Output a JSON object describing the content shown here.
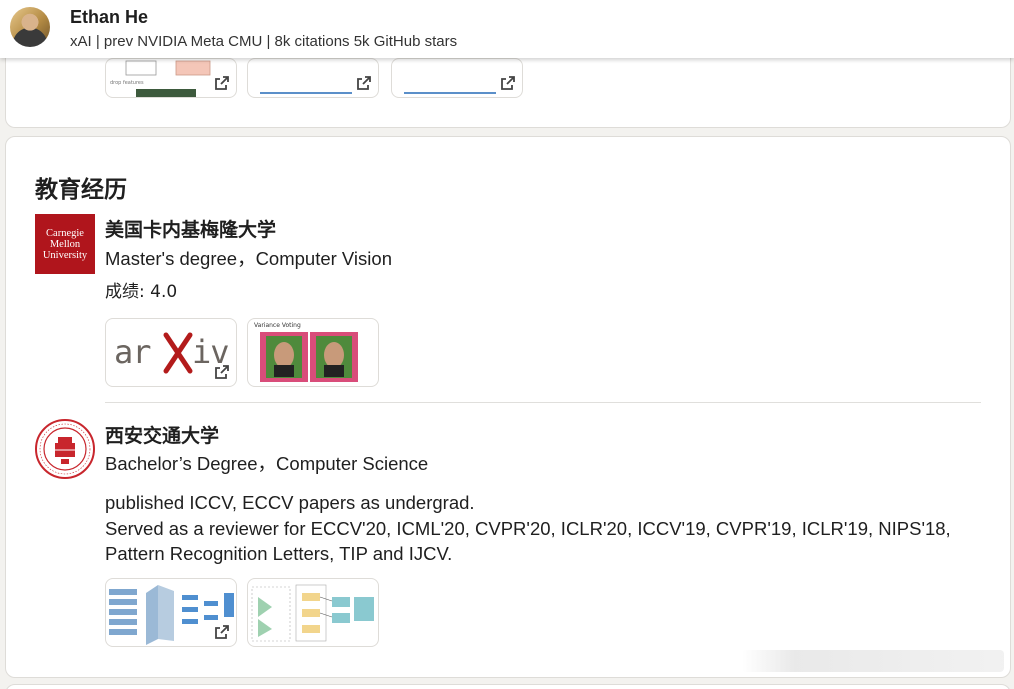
{
  "header": {
    "name": "Ethan He",
    "headline": "xAI | prev NVIDIA Meta CMU | 8k citations 5k GitHub stars"
  },
  "education": {
    "title": "教育经历",
    "schools": [
      {
        "name": "美国卡内基梅隆大学",
        "logo_lines": [
          "Carnegie",
          "Mellon",
          "University"
        ],
        "degree": "Master's degree，Computer Vision",
        "grade": "成绩: 4.0",
        "media_icons": [
          "arxiv-thumbnail",
          "variance-voting-thumbnail"
        ],
        "media_caption": "Variance Voting"
      },
      {
        "name": "西安交通大学",
        "degree": "Bachelor’s Degree，Computer Science",
        "description": [
          "published ICCV, ECCV papers as undergrad.",
          "Served as a reviewer for ECCV'20, ICML'20, CVPR'20, ICLR'20, ICCV'19, CVPR'19, ICLR'19, NIPS'18,",
          "Pattern Recognition Letters, TIP and IJCV."
        ],
        "media_icons": [
          "network-diagram-thumbnail",
          "architecture-diagram-thumbnail"
        ]
      }
    ]
  },
  "colors": {
    "cmu_red": "#b0151c",
    "xjtu_red": "#c8262d",
    "card_border": "#dedcd8",
    "page_bg": "#f3f2ef"
  }
}
